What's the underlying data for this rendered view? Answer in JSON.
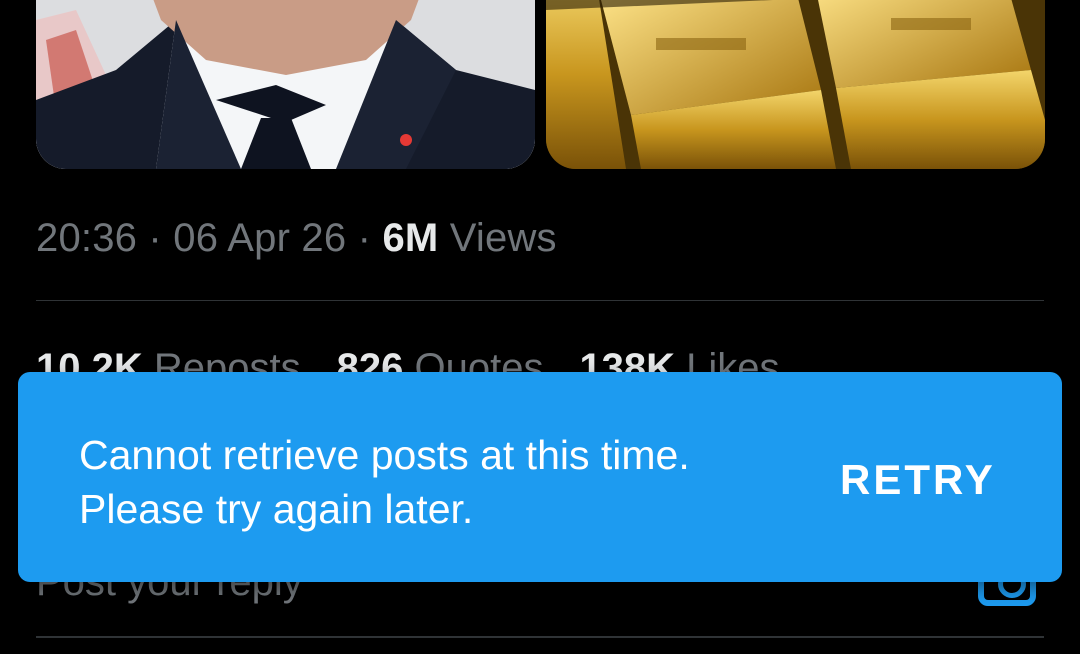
{
  "media": [
    {
      "icon": "portrait-photo"
    },
    {
      "icon": "gold-bars-photo"
    }
  ],
  "meta": {
    "time": "20:36",
    "sep1": " · ",
    "date": "06 Apr 26",
    "sep2": " · ",
    "views_count": "6M",
    "views_label": " Views"
  },
  "stats": {
    "reposts_count": "10.2K",
    "reposts_label": " Reposts",
    "quotes_count": "826",
    "quotes_label": " Quotes",
    "likes_count": "138K",
    "likes_label": " Likes"
  },
  "reply": {
    "placeholder": "Post your reply",
    "camera_icon": "camera-icon"
  },
  "toast": {
    "message": "Cannot retrieve posts at this time. Please try again later.",
    "retry_label": "RETRY",
    "color": "#1d9bf0"
  }
}
